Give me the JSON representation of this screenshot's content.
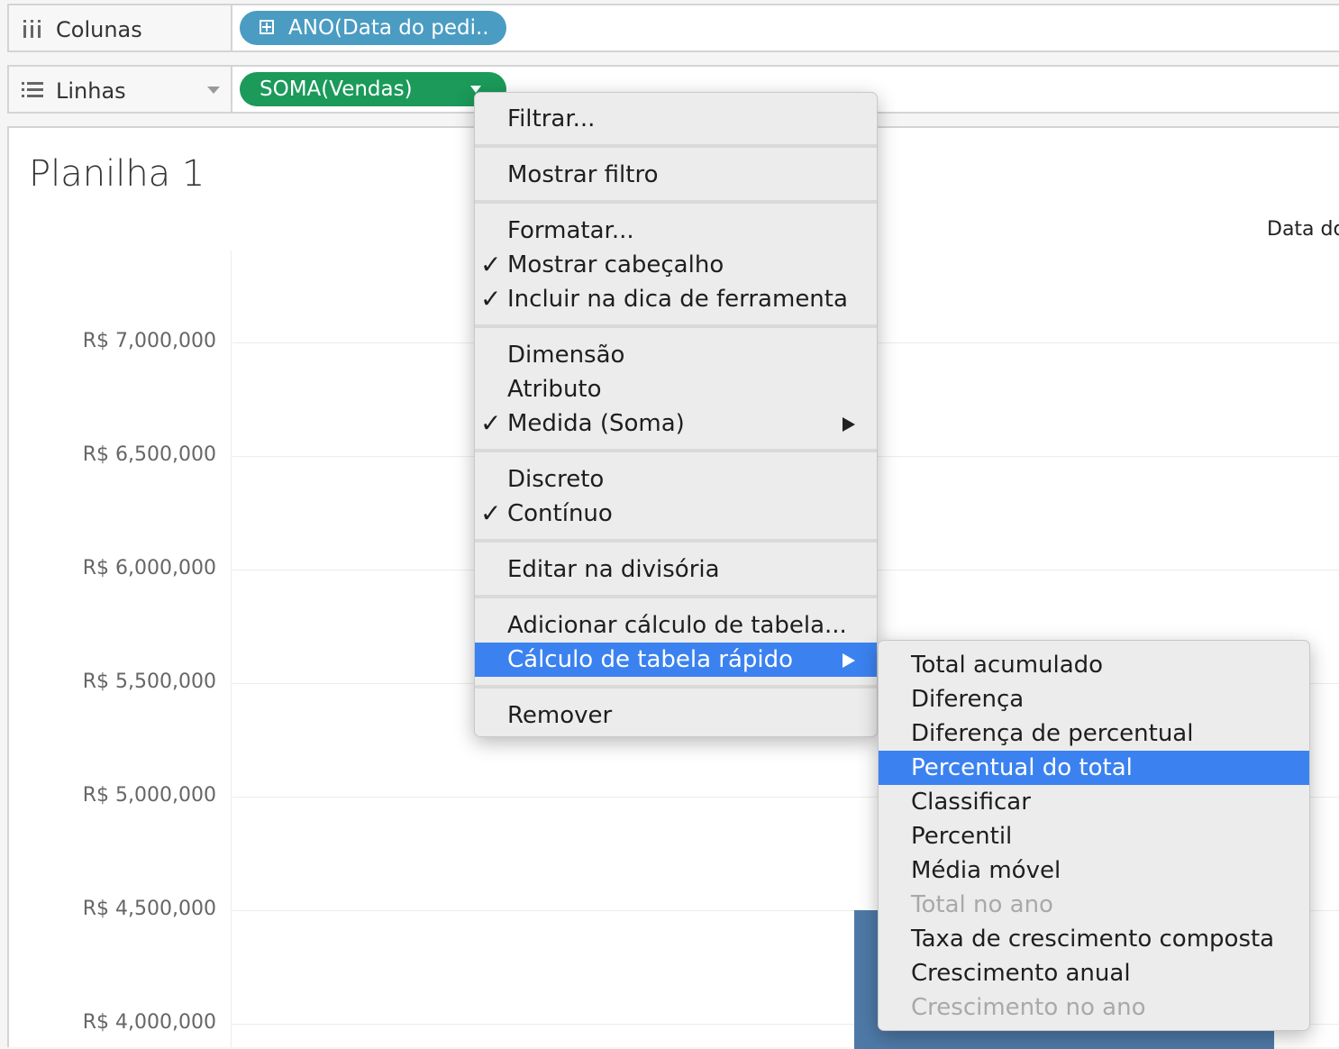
{
  "shelves": {
    "columns": {
      "label": "Colunas",
      "pill": "ANO(Data do pedi.."
    },
    "rows": {
      "label": "Linhas",
      "pill": "SOMA(Vendas)"
    }
  },
  "sheet": {
    "title": "Planilha 1",
    "column_header": "Data do"
  },
  "chart_data": {
    "type": "bar",
    "ylabel": "",
    "yticks": [
      "R$ 7,000,000",
      "R$ 6,500,000",
      "R$ 6,000,000",
      "R$ 5,500,000",
      "R$ 5,000,000",
      "R$ 4,500,000",
      "R$ 4,000,000"
    ],
    "ylim": [
      3900000,
      7400000
    ],
    "values": [
      4500000
    ],
    "color": "#4e79a7"
  },
  "context_menu": {
    "items": [
      {
        "label": "Filtrar...",
        "checked": false
      },
      {
        "label": "Mostrar filtro",
        "checked": false
      },
      {
        "label": "Formatar...",
        "checked": false
      },
      {
        "label": "Mostrar cabeçalho",
        "checked": true
      },
      {
        "label": "Incluir na dica de ferramenta",
        "checked": true
      },
      {
        "label": "Dimensão",
        "checked": false
      },
      {
        "label": "Atributo",
        "checked": false
      },
      {
        "label": "Medida (Soma)",
        "checked": true,
        "submenu": true
      },
      {
        "label": "Discreto",
        "checked": false
      },
      {
        "label": "Contínuo",
        "checked": true
      },
      {
        "label": "Editar na divisória",
        "checked": false
      },
      {
        "label": "Adicionar cálculo de tabela...",
        "checked": false
      },
      {
        "label": "Cálculo de tabela rápido",
        "checked": false,
        "submenu": true,
        "selected": true
      },
      {
        "label": "Remover",
        "checked": false
      }
    ],
    "check_glyph": "✓"
  },
  "quick_calc_submenu": {
    "items": [
      {
        "label": "Total acumulado",
        "enabled": true
      },
      {
        "label": "Diferença",
        "enabled": true
      },
      {
        "label": "Diferença de percentual",
        "enabled": true
      },
      {
        "label": "Percentual do total",
        "enabled": true,
        "selected": true
      },
      {
        "label": "Classificar",
        "enabled": true
      },
      {
        "label": "Percentil",
        "enabled": true
      },
      {
        "label": "Média móvel",
        "enabled": true
      },
      {
        "label": "Total no ano",
        "enabled": false
      },
      {
        "label": "Taxa de crescimento composta",
        "enabled": true
      },
      {
        "label": "Crescimento anual",
        "enabled": true
      },
      {
        "label": "Crescimento no ano",
        "enabled": false
      }
    ]
  },
  "colors": {
    "columns_pill": "#4b9cc2",
    "rows_pill": "#1b9a5a",
    "highlight": "#3b82f0"
  }
}
